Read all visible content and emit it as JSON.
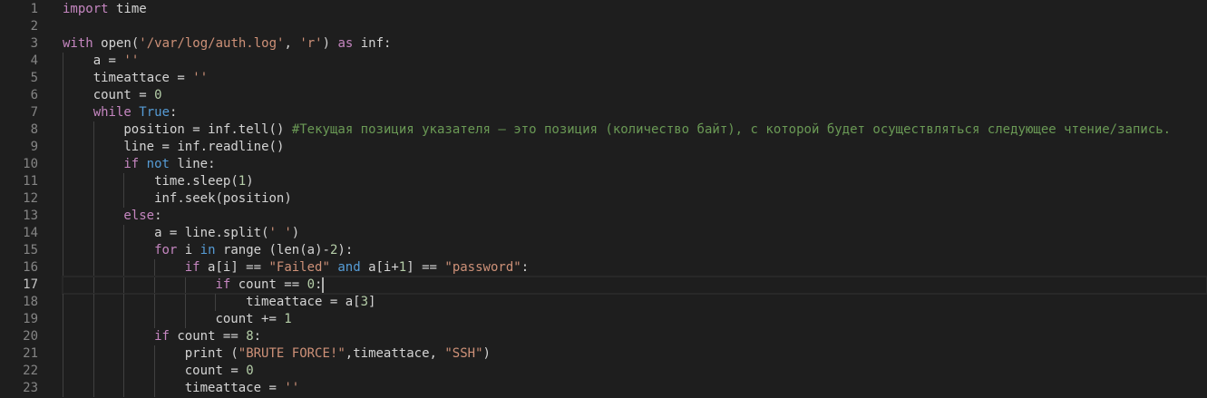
{
  "editor": {
    "language": "python",
    "current_line": 17,
    "colors": {
      "keyword": "#c586c0",
      "constant": "#569cd6",
      "string": "#ce9178",
      "number": "#b5cea8",
      "comment": "#6a9955",
      "text": "#d4d4d4",
      "background": "#1e1e1e"
    },
    "lines": [
      {
        "n": "1",
        "tokens": [
          [
            "k",
            "import"
          ],
          [
            "t",
            " time"
          ]
        ]
      },
      {
        "n": "2",
        "tokens": []
      },
      {
        "n": "3",
        "tokens": [
          [
            "k",
            "with"
          ],
          [
            "t",
            " open("
          ],
          [
            "s",
            "'/var/log/auth.log'"
          ],
          [
            "t",
            ", "
          ],
          [
            "s",
            "'r'"
          ],
          [
            "t",
            ") "
          ],
          [
            "k",
            "as"
          ],
          [
            "t",
            " inf:"
          ]
        ]
      },
      {
        "n": "4",
        "tokens": [
          [
            "t",
            "    a = "
          ],
          [
            "s",
            "''"
          ]
        ]
      },
      {
        "n": "5",
        "tokens": [
          [
            "t",
            "    timeattace = "
          ],
          [
            "s",
            "''"
          ]
        ]
      },
      {
        "n": "6",
        "tokens": [
          [
            "t",
            "    count = "
          ],
          [
            "n",
            "0"
          ]
        ]
      },
      {
        "n": "7",
        "tokens": [
          [
            "t",
            "    "
          ],
          [
            "k",
            "while"
          ],
          [
            "t",
            " "
          ],
          [
            "b",
            "True"
          ],
          [
            "t",
            ":"
          ]
        ]
      },
      {
        "n": "8",
        "tokens": [
          [
            "t",
            "        position = inf.tell() "
          ],
          [
            "c",
            "#Текущая позиция указателя — это позиция (количество байт), с которой будет осуществляться следующее чтение/запись."
          ]
        ]
      },
      {
        "n": "9",
        "tokens": [
          [
            "t",
            "        line = inf.readline()"
          ]
        ]
      },
      {
        "n": "10",
        "tokens": [
          [
            "t",
            "        "
          ],
          [
            "k",
            "if"
          ],
          [
            "t",
            " "
          ],
          [
            "b",
            "not"
          ],
          [
            "t",
            " line:"
          ]
        ]
      },
      {
        "n": "11",
        "tokens": [
          [
            "t",
            "            time.sleep("
          ],
          [
            "n",
            "1"
          ],
          [
            "t",
            ")"
          ]
        ]
      },
      {
        "n": "12",
        "tokens": [
          [
            "t",
            "            inf.seek(position)"
          ]
        ]
      },
      {
        "n": "13",
        "tokens": [
          [
            "t",
            "        "
          ],
          [
            "k",
            "else"
          ],
          [
            "t",
            ":"
          ]
        ]
      },
      {
        "n": "14",
        "tokens": [
          [
            "t",
            "            a = line.split("
          ],
          [
            "s",
            "' '"
          ],
          [
            "t",
            ")"
          ]
        ]
      },
      {
        "n": "15",
        "tokens": [
          [
            "t",
            "            "
          ],
          [
            "k",
            "for"
          ],
          [
            "t",
            " i "
          ],
          [
            "b",
            "in"
          ],
          [
            "t",
            " range (len(a)-"
          ],
          [
            "n",
            "2"
          ],
          [
            "t",
            "):"
          ]
        ]
      },
      {
        "n": "16",
        "tokens": [
          [
            "t",
            "                "
          ],
          [
            "k",
            "if"
          ],
          [
            "t",
            " a[i] == "
          ],
          [
            "s",
            "\"Failed\""
          ],
          [
            "t",
            " "
          ],
          [
            "b",
            "and"
          ],
          [
            "t",
            " a[i+"
          ],
          [
            "n",
            "1"
          ],
          [
            "t",
            "] == "
          ],
          [
            "s",
            "\"password\""
          ],
          [
            "t",
            ":"
          ]
        ]
      },
      {
        "n": "17",
        "tokens": [
          [
            "t",
            "                    "
          ],
          [
            "k",
            "if"
          ],
          [
            "t",
            " count == "
          ],
          [
            "n",
            "0"
          ],
          [
            "t",
            ":"
          ]
        ]
      },
      {
        "n": "18",
        "tokens": [
          [
            "t",
            "                        timeattace = a["
          ],
          [
            "n",
            "3"
          ],
          [
            "t",
            "]"
          ]
        ]
      },
      {
        "n": "19",
        "tokens": [
          [
            "t",
            "                    count += "
          ],
          [
            "n",
            "1"
          ]
        ]
      },
      {
        "n": "20",
        "tokens": [
          [
            "t",
            "            "
          ],
          [
            "k",
            "if"
          ],
          [
            "t",
            " count == "
          ],
          [
            "n",
            "8"
          ],
          [
            "t",
            ":"
          ]
        ]
      },
      {
        "n": "21",
        "tokens": [
          [
            "t",
            "                print ("
          ],
          [
            "s",
            "\"BRUTE FORCE!\""
          ],
          [
            "t",
            ",timeattace, "
          ],
          [
            "s",
            "\"SSH\""
          ],
          [
            "t",
            ")"
          ]
        ]
      },
      {
        "n": "22",
        "tokens": [
          [
            "t",
            "                count = "
          ],
          [
            "n",
            "0"
          ]
        ]
      },
      {
        "n": "23",
        "tokens": [
          [
            "t",
            "                timeattace = "
          ],
          [
            "s",
            "''"
          ]
        ]
      }
    ]
  }
}
